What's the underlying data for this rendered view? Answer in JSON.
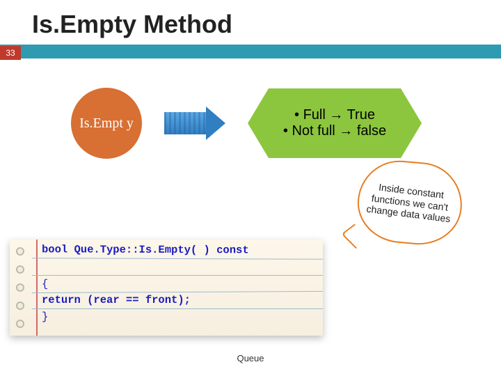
{
  "page_number": "33",
  "title": "Is.Empty Method",
  "row": {
    "circle_text": "Is.Empt\ny",
    "hex_line1": "• Full → True",
    "hex_line2": "• Not full → false"
  },
  "callout": "Inside constant functions we can't change data values",
  "code": {
    "line1": "bool Que.Type::Is.Empty( )  const",
    "line2": " ",
    "line3": "{",
    "line4": "   return (rear == front);",
    "line5": "}"
  },
  "footer": "Queue"
}
